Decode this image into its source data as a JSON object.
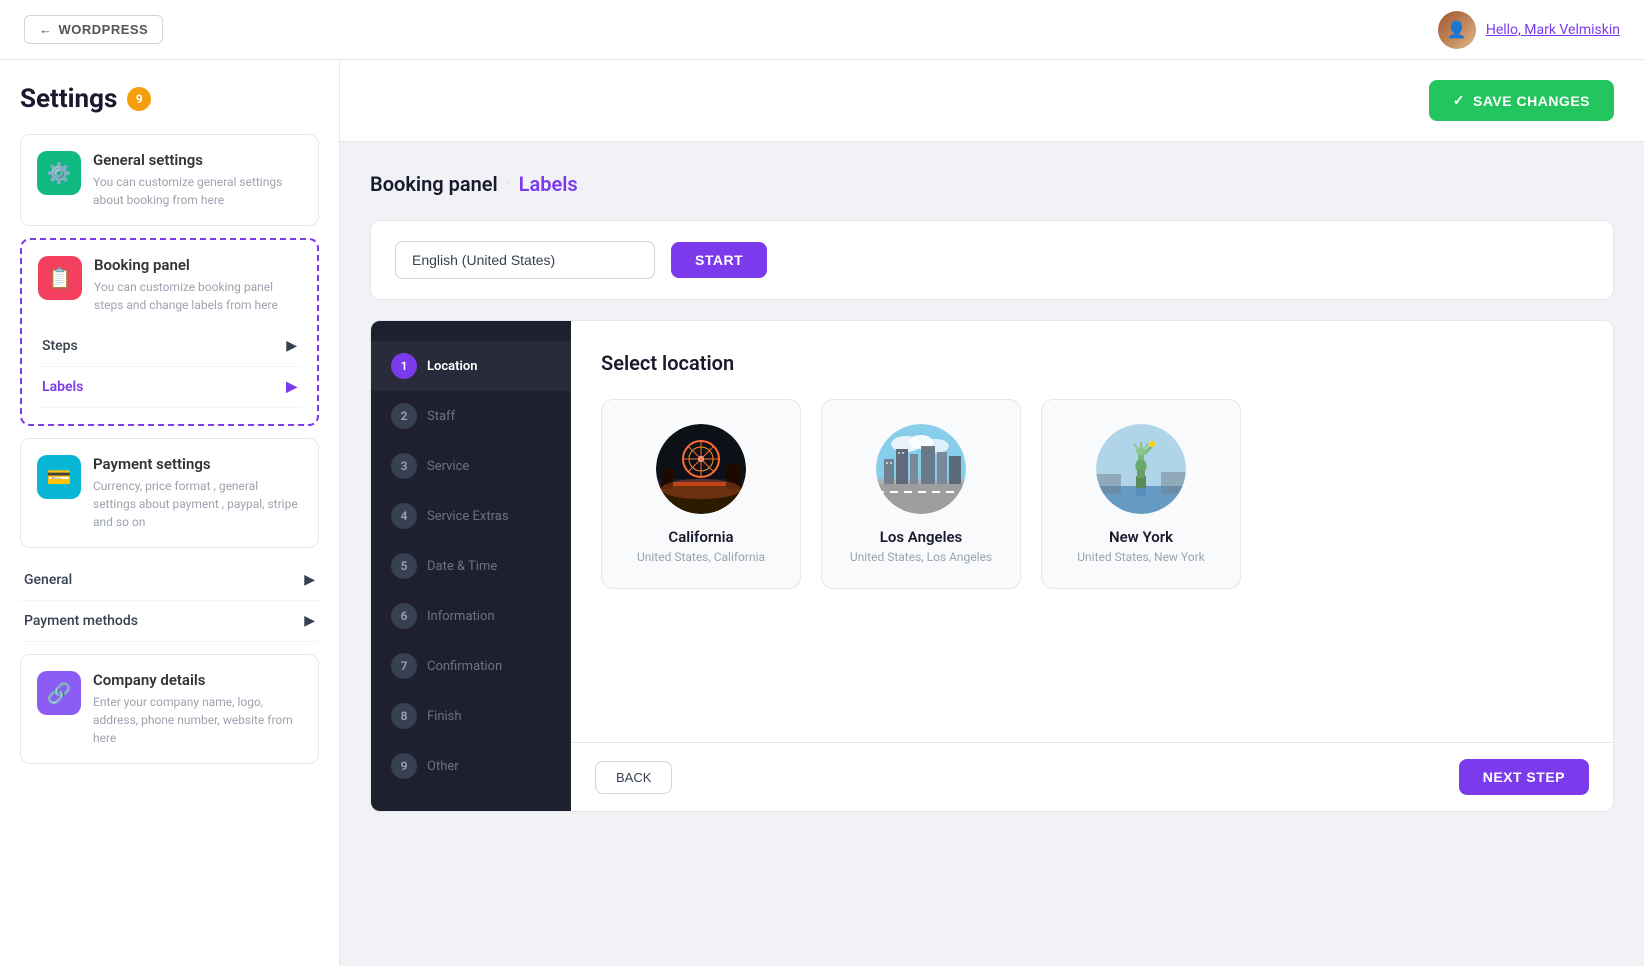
{
  "topbar": {
    "back_label": "WORDPRESS",
    "user_greeting": "Hello, Mark Velmiskin"
  },
  "sidebar": {
    "title": "Settings",
    "badge": "9",
    "cards": [
      {
        "id": "general-settings",
        "icon": "⚙️",
        "icon_class": "icon-green",
        "title": "General settings",
        "desc": "You can customize general settings about booking from here"
      },
      {
        "id": "booking-panel",
        "icon": "📋",
        "icon_class": "icon-pink",
        "title": "Booking panel",
        "desc": "You can customize booking panel steps and change labels from here",
        "active": true
      }
    ],
    "expandables": [
      {
        "id": "steps",
        "label": "Steps",
        "active": false
      },
      {
        "id": "labels",
        "label": "Labels",
        "active": true
      }
    ],
    "bottom_cards": [
      {
        "id": "payment-settings",
        "icon": "💳",
        "icon_class": "icon-teal",
        "title": "Payment settings",
        "desc": "Currency, price format , general settings about payment , paypal, stripe and so on"
      }
    ],
    "expandables2": [
      {
        "id": "general",
        "label": "General",
        "active": false
      },
      {
        "id": "payment-methods",
        "label": "Payment methods",
        "active": false
      }
    ],
    "bottom_cards2": [
      {
        "id": "company-details",
        "icon": "🔗",
        "icon_class": "icon-purple",
        "title": "Company details",
        "desc": "Enter your company name, logo, address, phone number, website from here"
      }
    ]
  },
  "header": {
    "save_label": "SAVE CHANGES"
  },
  "breadcrumb": {
    "parent": "Booking panel",
    "separator": "·",
    "current": "Labels"
  },
  "language": {
    "selected": "English (United States)",
    "start_label": "START"
  },
  "steps": [
    {
      "num": "1",
      "label": "Location",
      "active": true
    },
    {
      "num": "2",
      "label": "Staff",
      "active": false
    },
    {
      "num": "3",
      "label": "Service",
      "active": false
    },
    {
      "num": "4",
      "label": "Service Extras",
      "active": false
    },
    {
      "num": "5",
      "label": "Date & Time",
      "active": false
    },
    {
      "num": "6",
      "label": "Information",
      "active": false
    },
    {
      "num": "7",
      "label": "Confirmation",
      "active": false
    },
    {
      "num": "8",
      "label": "Finish",
      "active": false
    },
    {
      "num": "9",
      "label": "Other",
      "active": false
    }
  ],
  "location": {
    "title": "Select location",
    "cards": [
      {
        "id": "california",
        "name": "California",
        "sub": "United States, California"
      },
      {
        "id": "los-angeles",
        "name": "Los Angeles",
        "sub": "United States, Los Angeles"
      },
      {
        "id": "new-york",
        "name": "New York",
        "sub": "United States, New York"
      }
    ]
  },
  "booking_footer": {
    "back_label": "BACK",
    "next_label": "NEXT STEP"
  }
}
